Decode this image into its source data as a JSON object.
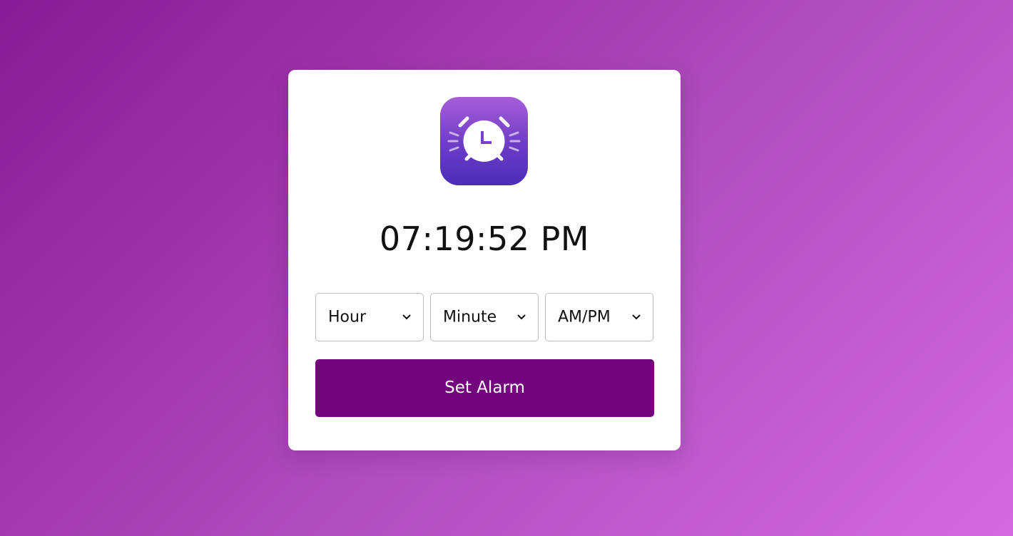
{
  "clock": {
    "time": "07:19:52 PM"
  },
  "app_icon": {
    "name": "alarm-clock-icon"
  },
  "selects": {
    "hour": {
      "selected": "Hour"
    },
    "minute": {
      "selected": "Minute"
    },
    "ampm": {
      "selected": "AM/PM"
    }
  },
  "actions": {
    "set_alarm_label": "Set Alarm"
  },
  "colors": {
    "button": "#73057c",
    "icon_top": "#a65ed8",
    "icon_bottom": "#4a2db8",
    "background_start": "#871b93",
    "background_end": "#d26ae0"
  }
}
